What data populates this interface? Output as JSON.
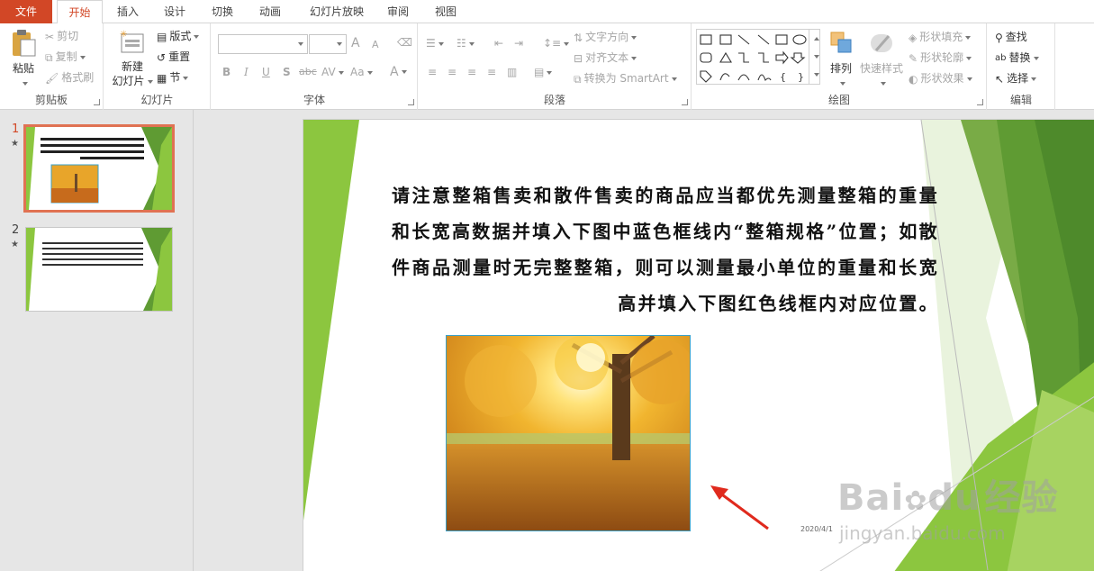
{
  "tabs": [
    {
      "label": "文件"
    },
    {
      "label": "开始"
    },
    {
      "label": "插入"
    },
    {
      "label": "设计"
    },
    {
      "label": "切换"
    },
    {
      "label": "动画"
    },
    {
      "label": "幻灯片放映"
    },
    {
      "label": "审阅"
    },
    {
      "label": "视图"
    }
  ],
  "ribbon": {
    "clipboard": {
      "group": "剪贴板",
      "paste": "粘贴",
      "cut": "剪切",
      "copy": "复制",
      "format_painter": "格式刷"
    },
    "slides": {
      "group": "幻灯片",
      "new_slide_1": "新建",
      "new_slide_2": "幻灯片",
      "layout": "版式",
      "reset": "重置",
      "section": "节"
    },
    "font": {
      "group": "字体",
      "bold": "B",
      "italic": "I",
      "underline": "U",
      "shadow": "S",
      "strike": "abc",
      "spacing": "AV",
      "case": "Aa",
      "color": "A",
      "grow": "A",
      "shrink": "A"
    },
    "paragraph": {
      "group": "段落",
      "text_direction": "文字方向",
      "align_text": "对齐文本",
      "smartart": "转换为 SmartArt"
    },
    "drawing": {
      "group": "绘图",
      "arrange": "排列",
      "quick_styles": "快速样式",
      "shape_fill": "形状填充",
      "shape_outline": "形状轮廓",
      "shape_effects": "形状效果"
    },
    "editing": {
      "group": "编辑",
      "find": "查找",
      "replace": "替换",
      "select": "选择"
    }
  },
  "thumbnails": [
    {
      "number": "1",
      "star": "★",
      "selected": true
    },
    {
      "number": "2",
      "star": "★",
      "selected": false
    }
  ],
  "slide": {
    "body_text": "请注意整箱售卖和散件售卖的商品应当都优先测量整箱的重量和长宽高数据并填入下图中蓝色框线内“整箱规格”位置；如散件商品测量时无完整整箱，则可以测量最小单位的重量和长宽高并填入下图红色线框内对应位置。",
    "date": "2020/4/1"
  },
  "watermark": {
    "brand": "Bai",
    "brand2": "du",
    "suffix": "经验",
    "url": "jingyan.baidu.com"
  },
  "colors": {
    "accent": "#d24726",
    "green": "#8cc63f",
    "dark_green": "#5f9b33",
    "photo_border": "#3aa0c8"
  }
}
